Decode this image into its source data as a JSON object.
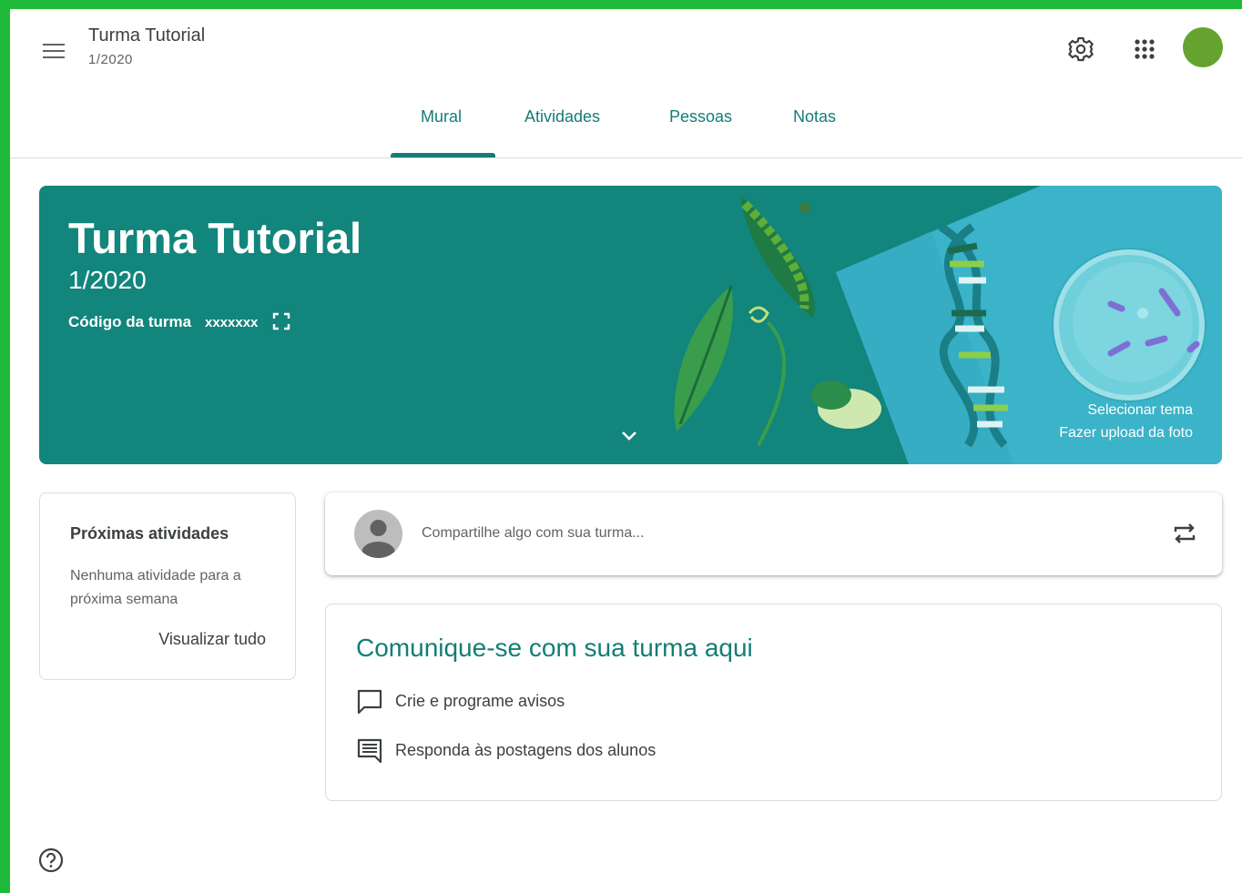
{
  "header": {
    "class_title": "Turma Tutorial",
    "class_period": "1/2020"
  },
  "tabs": [
    {
      "label": "Mural",
      "active": true
    },
    {
      "label": "Atividades",
      "active": false
    },
    {
      "label": "Pessoas",
      "active": false
    },
    {
      "label": "Notas",
      "active": false
    }
  ],
  "banner": {
    "title": "Turma Tutorial",
    "subtitle": "1/2020",
    "code_label": "Código da turma",
    "code_value": "xxxxxxx",
    "select_theme": "Selecionar tema",
    "upload_photo": "Fazer upload da foto"
  },
  "upcoming": {
    "title": "Próximas atividades",
    "description": "Nenhuma atividade para a próxima semana",
    "view_all": "Visualizar tudo"
  },
  "share": {
    "placeholder": "Compartilhe algo com sua turma..."
  },
  "communicate": {
    "title": "Comunique-se com sua turma aqui",
    "items": [
      {
        "label": "Crie e programe avisos",
        "icon": "chat-bubble-icon"
      },
      {
        "label": "Responda às postagens dos alunos",
        "icon": "message-lines-icon"
      }
    ]
  },
  "colors": {
    "accent": "#137e76",
    "banner": "#12857c",
    "frame": "#1fba3a",
    "avatar": "#65a32e"
  },
  "icons": [
    "menu-icon",
    "gear-icon",
    "apps-grid-icon",
    "expand-icon",
    "chevron-down-icon",
    "repost-icon",
    "help-icon"
  ]
}
